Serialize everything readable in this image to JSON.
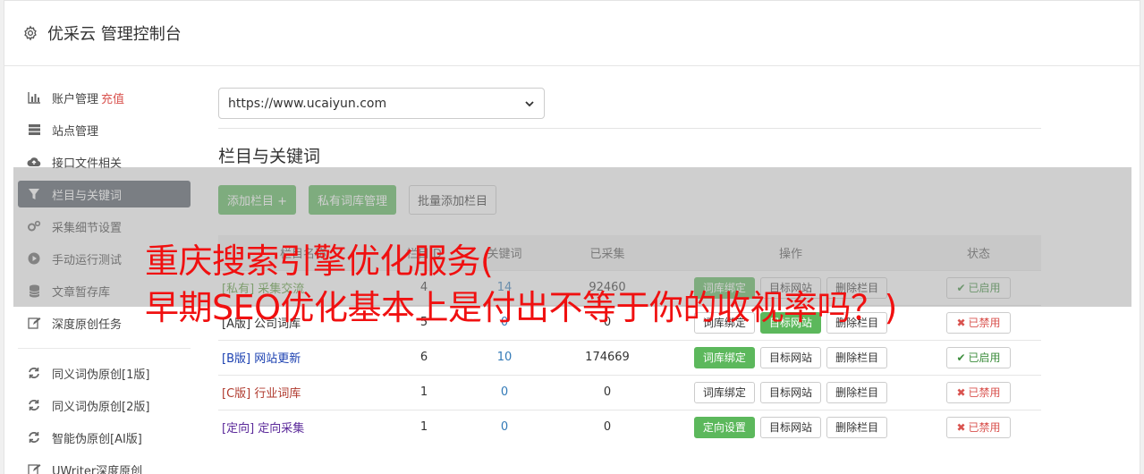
{
  "header": {
    "title": "优采云 管理控制台",
    "icon": "gear-icon"
  },
  "sidebar": {
    "items": [
      {
        "label": "账户管理",
        "badge": "充值",
        "icon": "bar-chart-icon"
      },
      {
        "label": "站点管理",
        "icon": "server-icon"
      },
      {
        "label": "接口文件相关",
        "icon": "cloud-upload-icon"
      },
      {
        "label": "栏目与关键词",
        "icon": "filter-icon",
        "active": true
      },
      {
        "label": "采集细节设置",
        "icon": "cogs-icon"
      },
      {
        "label": "手动运行测试",
        "icon": "play-circle-icon"
      },
      {
        "label": "文章暂存库",
        "icon": "database-icon"
      },
      {
        "label": "深度原创任务",
        "icon": "edit-icon"
      }
    ],
    "items2": [
      {
        "label": "同义词伪原创[1版]",
        "icon": "refresh-icon"
      },
      {
        "label": "同义词伪原创[2版]",
        "icon": "refresh-icon"
      },
      {
        "label": "智能伪原创[AI版]",
        "icon": "refresh-icon"
      },
      {
        "label": "UWriter深度原创",
        "icon": "edit-icon"
      }
    ]
  },
  "site_select": {
    "value": "https://www.ucaiyun.com"
  },
  "section": {
    "title": "栏目与关键词"
  },
  "buttons": {
    "add_column": "添加栏目 +",
    "private_lib": "私有词库管理",
    "batch_add": "批量添加栏目"
  },
  "table": {
    "headers": [
      "栏目名称",
      "栏目ID",
      "关键词",
      "已采集",
      "操作",
      "状态"
    ],
    "rows": [
      {
        "name": "[私有] 采集交流",
        "id": "4",
        "keywords": "14",
        "collected": "92460",
        "op1": "词库绑定",
        "op2": "目标网站",
        "op3": "删除栏目",
        "status": "已启用"
      },
      {
        "name": "[A版] 公司词库",
        "id": "5",
        "keywords": "0",
        "collected": "0",
        "op1": "词库绑定",
        "op2": "目标网站",
        "op3": "删除栏目",
        "status": "已禁用"
      },
      {
        "name": "[B版] 网站更新",
        "id": "6",
        "keywords": "10",
        "collected": "174669",
        "op1": "词库绑定",
        "op2": "目标网站",
        "op3": "删除栏目",
        "status": "已启用"
      },
      {
        "name": "[C版] 行业词库",
        "id": "1",
        "keywords": "0",
        "collected": "0",
        "op1": "词库绑定",
        "op2": "目标网站",
        "op3": "删除栏目",
        "status": "已禁用"
      },
      {
        "name": "[定向] 定向采集",
        "id": "1",
        "keywords": "0",
        "collected": "0",
        "op1": "定向设置",
        "op2": "目标网站",
        "op3": "删除栏目",
        "status": "已禁用"
      }
    ]
  },
  "overlay": {
    "line1": "重庆搜索引擎优化服务(",
    "line2": "早期SEO优化基本上是付出不等于你的收视率吗？)"
  },
  "colors": {
    "accent_green": "#5cb85c",
    "active_nav": "#555d66",
    "danger": "#d9534f",
    "headline": "#f01010"
  }
}
